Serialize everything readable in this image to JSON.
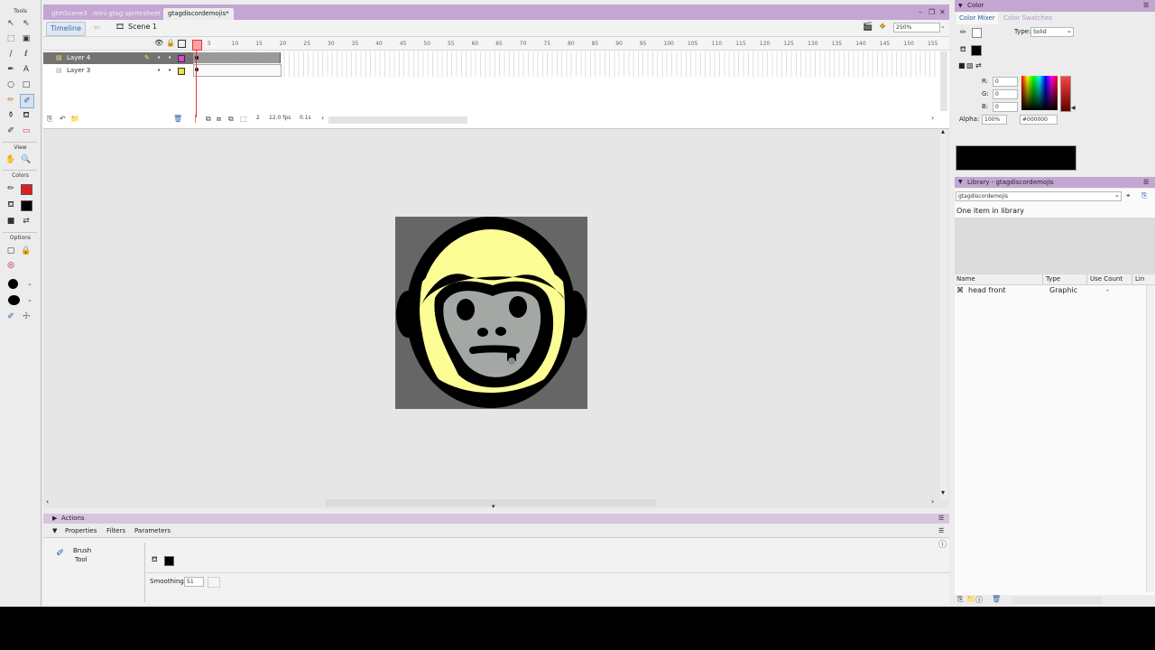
{
  "tools_panel": {
    "header": "Tools",
    "view_label": "View",
    "colors_label": "Colors",
    "options_label": "Options"
  },
  "document_tabs": [
    {
      "label": "gtmScene3",
      "active": false
    },
    {
      "label": "mini gtag spritesheet",
      "active": false
    },
    {
      "label": "gtagdiscordemojis*",
      "active": true
    }
  ],
  "timeline_bar": {
    "timeline_button": "Timeline",
    "scene_label": "Scene 1",
    "zoom_value": "250%"
  },
  "timeline": {
    "layers": [
      {
        "name": "Layer 4",
        "selected": true
      },
      {
        "name": "Layer 3",
        "selected": false
      }
    ],
    "ruler": [
      "5",
      "10",
      "15",
      "20",
      "25",
      "30",
      "35",
      "40",
      "45",
      "50",
      "55",
      "60",
      "65",
      "70",
      "75",
      "80",
      "85",
      "90",
      "95",
      "100",
      "105",
      "110",
      "115",
      "120",
      "125",
      "130",
      "135",
      "140",
      "145",
      "150",
      "155"
    ],
    "current_frame": "2",
    "frame_rate": "12.0 fps",
    "elapsed": "0.1s"
  },
  "stage": {
    "canvas_background": "#666666",
    "face_yellow": "#fdfd96",
    "face_gray": "#a4a8a4"
  },
  "actions_panel": {
    "title": "Actions"
  },
  "properties_panel": {
    "tabs": [
      "Properties",
      "Filters",
      "Parameters"
    ],
    "tool_name_line1": "Brush",
    "tool_name_line2": "Tool",
    "smoothing_label": "Smoothing",
    "smoothing_value": "51"
  },
  "color_panel": {
    "title": "Color",
    "tabs": [
      "Color Mixer",
      "Color Swatches"
    ],
    "type_label": "Type:",
    "type_value": "Solid",
    "r_label": "R:",
    "r_value": "0",
    "g_label": "G:",
    "g_value": "0",
    "b_label": "B:",
    "b_value": "0",
    "alpha_label": "Alpha:",
    "alpha_value": "100%",
    "hex_value": "#000000",
    "preview_color": "#000000"
  },
  "library_panel": {
    "title": "Library - gtagdiscordemojis",
    "dropdown_value": "gtagdiscordemojis",
    "item_count": "One item in library",
    "columns": [
      "Name",
      "Type",
      "Use Count",
      "Lin"
    ],
    "items": [
      {
        "name": "head front",
        "type": "Graphic",
        "use_count": "-"
      }
    ]
  }
}
